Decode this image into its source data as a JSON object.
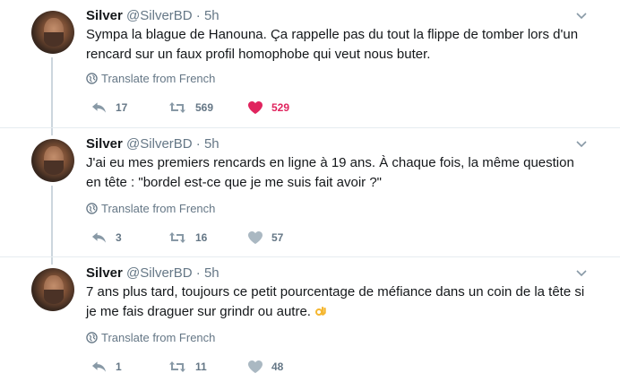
{
  "tweets": [
    {
      "name": "Silver",
      "handle": "@SilverBD · 5h",
      "text": "Sympa la blague de Hanouna. Ça rappelle pas du tout la flippe de tomber lors d'un rencard sur un faux profil homophobe qui veut nous buter.",
      "translate": "Translate from French",
      "replies": "17",
      "retweets": "569",
      "likes": "529",
      "liked": true
    },
    {
      "name": "Silver",
      "handle": "@SilverBD · 5h",
      "text": "J'ai eu mes premiers rencards en ligne à 19 ans. À chaque fois, la même question en tête : \"bordel est-ce que je me suis fait avoir ?\"",
      "translate": "Translate from French",
      "replies": "3",
      "retweets": "16",
      "likes": "57",
      "liked": false
    },
    {
      "name": "Silver",
      "handle": "@SilverBD · 5h",
      "text": "7 ans plus tard, toujours ce petit pourcentage de méfiance dans un coin de la tête si je me fais draguer sur grindr ou autre.",
      "emoji": "ok-hand-emoji",
      "translate": "Translate from French",
      "replies": "1",
      "retweets": "11",
      "likes": "48",
      "liked": false
    }
  ],
  "colors": {
    "text": "#14171a",
    "muted": "#657786",
    "like_active": "#e0245e",
    "divider": "#e6ecf0",
    "thread_line": "#ccd6dd"
  },
  "icons": [
    "caret-down-icon",
    "globe-icon",
    "reply-icon",
    "retweet-icon",
    "heart-icon"
  ]
}
